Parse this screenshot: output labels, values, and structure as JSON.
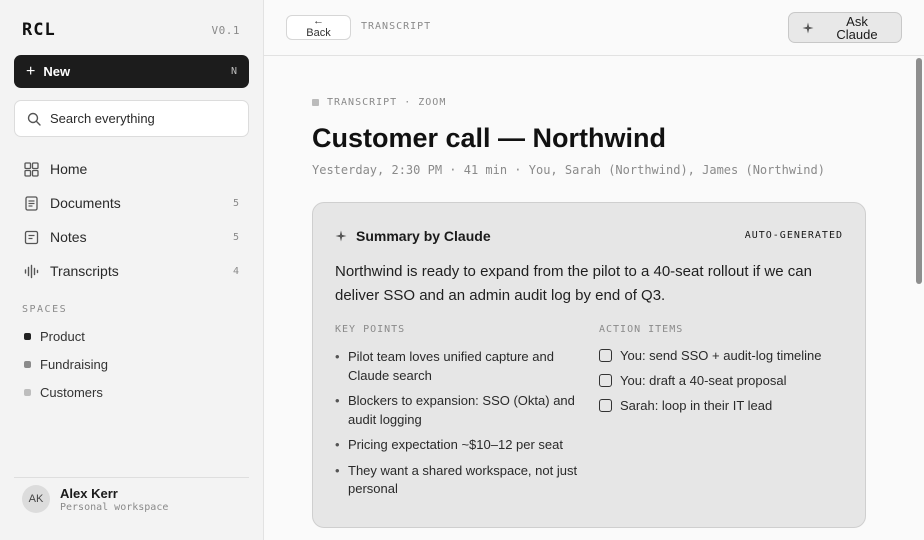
{
  "sidebar": {
    "brand": "RCL",
    "version": "V0.1",
    "new_button": {
      "label": "New",
      "shortcut": "N"
    },
    "search": {
      "placeholder": "Search everything"
    },
    "nav": [
      {
        "label": "Home",
        "count": "",
        "icon": "grid-icon"
      },
      {
        "label": "Documents",
        "count": "5",
        "icon": "document-icon"
      },
      {
        "label": "Notes",
        "count": "5",
        "icon": "notes-icon"
      },
      {
        "label": "Transcripts",
        "count": "4",
        "icon": "waveform-icon"
      }
    ],
    "spaces_title": "SPACES",
    "spaces": [
      {
        "label": "Product",
        "color": "#222222"
      },
      {
        "label": "Fundraising",
        "color": "#8a8a8a"
      },
      {
        "label": "Customers",
        "color": "#bdbdbd"
      }
    ],
    "user": {
      "initials": "AK",
      "name": "Alex Kerr",
      "subtitle": "Personal workspace"
    }
  },
  "topbar": {
    "back_arrow": "←",
    "back_label": "Back",
    "breadcrumb": "TRANSCRIPT",
    "ask_label": "Ask Claude"
  },
  "doc": {
    "kicker": "TRANSCRIPT · ZOOM",
    "title": "Customer call — Northwind",
    "meta": "Yesterday, 2:30 PM · 41 min · You, Sarah (Northwind), James (Northwind)"
  },
  "summary_card": {
    "title": "Summary by Claude",
    "badge": "AUTO-GENERATED",
    "summary": "Northwind is ready to expand from the pilot to a 40-seat rollout if we can deliver SSO and an admin audit log by end of Q3.",
    "key_points_title": "KEY POINTS",
    "key_points": [
      "Pilot team loves unified capture and Claude search",
      "Blockers to expansion: SSO (Okta) and audit logging",
      "Pricing expectation ~$10–12 per seat",
      "They want a shared workspace, not just personal"
    ],
    "action_items_title": "ACTION ITEMS",
    "action_items": [
      "You: send SSO + audit-log timeline",
      "You: draft a 40-seat proposal",
      "Sarah: loop in their IT lead"
    ]
  }
}
